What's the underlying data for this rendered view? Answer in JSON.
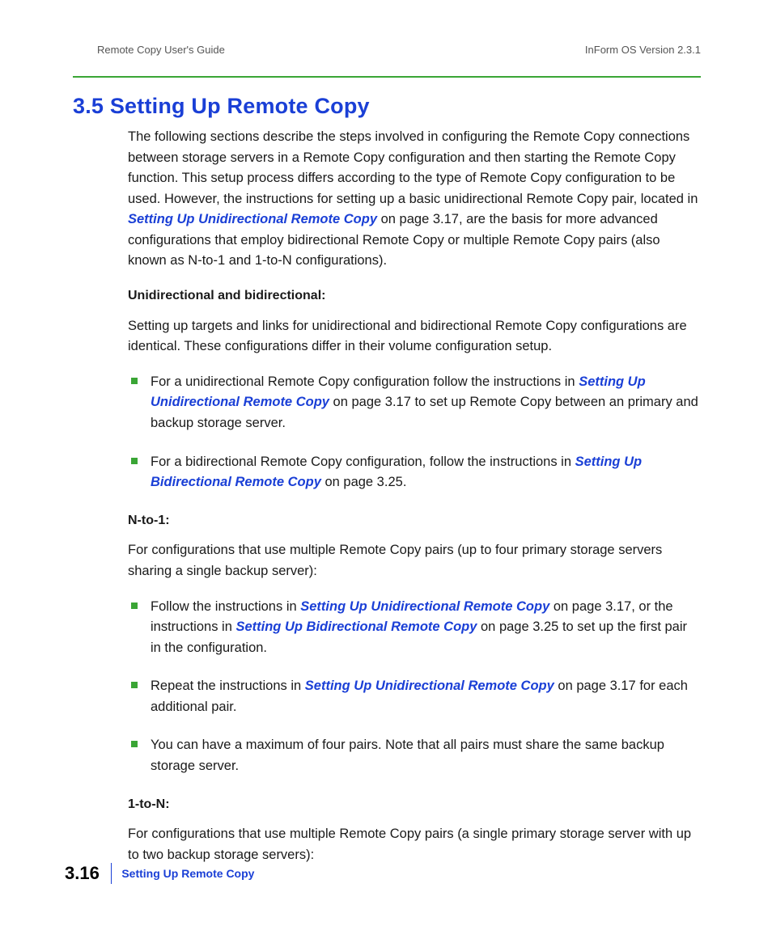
{
  "header": {
    "left": "Remote Copy User's Guide",
    "right": "InForm OS Version 2.3.1"
  },
  "heading": "3.5  Setting Up Remote Copy",
  "intro": {
    "text_before_link": "The following sections describe the steps involved in configuring the Remote Copy connections between storage servers in a Remote Copy configuration and then starting the Remote Copy function. This setup process differs according to the type of Remote Copy configuration to be used. However, the instructions for setting up a basic unidirectional Remote Copy pair, located in ",
    "link": "Setting Up Unidirectional Remote Copy",
    "pageref": " on page 3.17",
    "text_after": ", are the basis for more advanced configurations that employ bidirectional Remote Copy or multiple Remote Copy pairs (also known as N-to-1 and 1-to-N configurations)."
  },
  "sub_unibi": {
    "title": "Unidirectional and bidirectional:",
    "para": "Setting up targets and links for unidirectional and bidirectional Remote Copy configurations are identical. These configurations differ in their volume configuration setup.",
    "bullets": [
      {
        "before": "For a unidirectional Remote Copy configuration follow the instructions in ",
        "link": "Setting Up Unidirectional Remote Copy",
        "pageref": " on page 3.17",
        "after": " to set up Remote Copy between an primary and backup storage server."
      },
      {
        "before": "For a bidirectional Remote Copy configuration, follow the instructions in ",
        "link": "Setting Up Bidirectional Remote Copy",
        "pageref": " on page 3.25",
        "after": "."
      }
    ]
  },
  "sub_nto1": {
    "title": "N-to-1:",
    "para": "For configurations that use multiple Remote Copy pairs (up to four primary storage servers sharing a single backup server):",
    "bullets": [
      {
        "before": "Follow the instructions in ",
        "link": "Setting Up Unidirectional Remote Copy",
        "pageref": " on page 3.17",
        "mid": ", or the instructions in ",
        "link2": "Setting Up Bidirectional Remote Copy",
        "pageref2": " on page 3.25",
        "after": " to set up the first pair in the configuration."
      },
      {
        "before": "Repeat the instructions in ",
        "link": "Setting Up Unidirectional Remote Copy",
        "pageref": " on page 3.17",
        "after": " for each additional pair."
      },
      {
        "plain": "You can have a maximum of four pairs. Note that all pairs must share the same backup storage server."
      }
    ]
  },
  "sub_1ton": {
    "title": "1-to-N:",
    "para": "For configurations that use multiple Remote Copy pairs (a single primary storage server with up to two backup storage servers):"
  },
  "footer": {
    "page": "3.16",
    "title": "Setting Up Remote Copy"
  }
}
